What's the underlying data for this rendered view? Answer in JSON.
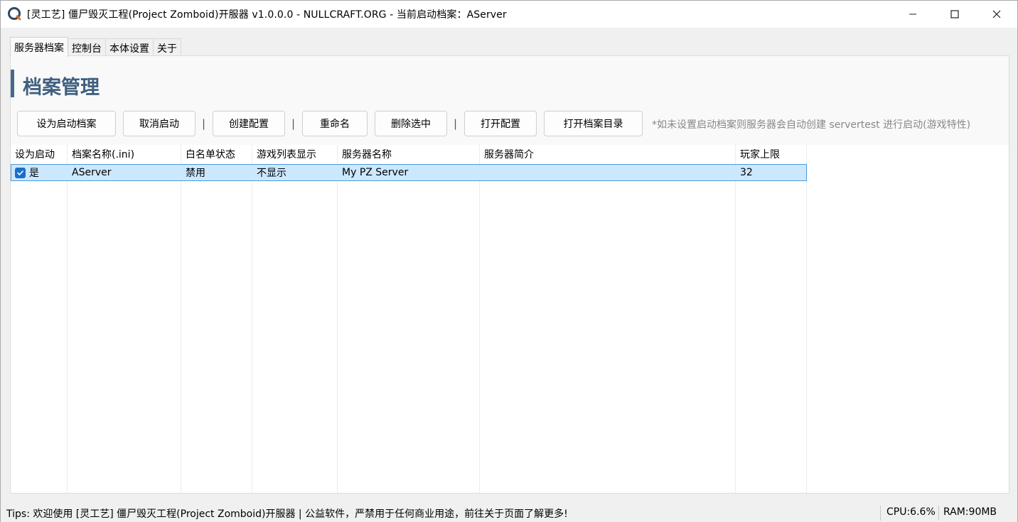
{
  "window": {
    "title": "[灵工艺] 僵尸毁灭工程(Project Zomboid)开服器 v1.0.0.0 - NULLCRAFT.ORG - 当前启动档案：AServer"
  },
  "tabs": [
    {
      "label": "服务器档案",
      "active": true
    },
    {
      "label": "控制台",
      "active": false
    },
    {
      "label": "本体设置",
      "active": false
    },
    {
      "label": "关于",
      "active": false
    }
  ],
  "section": {
    "title": "档案管理"
  },
  "toolbar": {
    "set_startup": "设为启动档案",
    "cancel_startup": "取消启动",
    "create_config": "创建配置",
    "rename": "重命名",
    "delete_selected": "删除选中",
    "open_config": "打开配置",
    "open_profile_dir": "打开档案目录",
    "separator": "|",
    "hint": "*如未设置启动档案则服务器会自动创建 servertest 进行启动(游戏特性)"
  },
  "table": {
    "columns": [
      "设为启动",
      "档案名称(.ini)",
      "白名单状态",
      "游戏列表显示",
      "服务器名称",
      "服务器简介",
      "玩家上限"
    ],
    "rows": [
      {
        "startup": "是",
        "startup_checked": true,
        "profile_name": "AServer",
        "whitelist": "禁用",
        "list_display": "不显示",
        "server_name": "My PZ Server",
        "description": "",
        "max_players": "32"
      }
    ]
  },
  "status": {
    "tips": "Tips:  欢迎使用 [灵工艺] 僵尸毁灭工程(Project Zomboid)开服器 | 公益软件，严禁用于任何商业用途，前往关于页面了解更多!",
    "cpu": "CPU:6.6%",
    "ram": "RAM:90MB"
  },
  "colors": {
    "accent": "#456a8a",
    "selection": "#cce8ff",
    "selection_border": "#4a9ad8",
    "checkbox": "#1a6fc7"
  },
  "icons": [
    "app-logo-icon",
    "minimize-icon",
    "maximize-icon",
    "close-icon",
    "checkbox-checked-icon"
  ]
}
